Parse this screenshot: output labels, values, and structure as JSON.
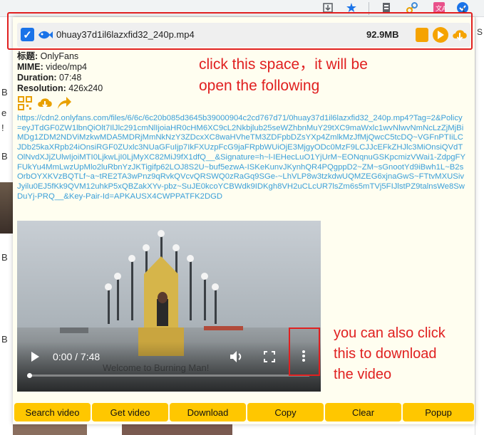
{
  "popup": {
    "file": {
      "name": "0huay37d1il6lazxfid32_240p.mp4",
      "size": "92.9MB",
      "checked": true
    },
    "info": {
      "title_label": "标题:",
      "title_value": "OnlyFans",
      "mime_label": "MIME:",
      "mime_value": "video/mp4",
      "duration_label": "Duration:",
      "duration_value": "07:48",
      "resolution_label": "Resolution:",
      "resolution_value": "426x240"
    },
    "url": "https://cdn2.onlyfans.com/files/6/6c/6c20b085d3645b39000904c2cd767d71/0huay37d1il6lazxfid32_240p.mp4?Tag=2&Policy=eyJTdGF0ZW1lbnQiOlt7IlJlc291cmNlIjoiaHR0cHM6XC9cL2Nkbjlub25seWZhbnMuY29tXC9maWxlc1wvNlwvNmNcLzZjMjBiMDg1ZDM2NDViMzkwMDA5MDRjMmNkNzY3ZDcxXC8waHVheTM3ZDFpbDZsYXp4ZmlkMzJfMjQwcC5tcDQ~VGFnPTIiLCJDb25kaXRpb24iOnsiRGF0ZUxlc3NUaGFuIjp7IkFXUzpFcG9jaFRpbWUiOjE3MjgyODc0MzF9LCJJcEFkZHJlc3MiOnsiQVdTOlNvdXJjZUlwIjoiMTI0LjkwLjI0LjMyXC82MiJ9fX1dfQ__&Signature=h~l-IEHecLuO1YjUrM~EONqnuGSKpcmizVWai1-ZdpgFYFUkYu4MmLwzUpMlo2luRbnYzJKTigifp62LOJ8S2U~buf5ezwA-ISKeKunvJKynhQR4PQgppD2~ZM~sGnootYd9iBwh1L~B2sOrbOYXKVzBQTLf~a~tRE2TA3wPnz9qRvkQVcvQRSWQ0zRaGq9SGe-~LhVLP8w3tzkdwUQMZEG6xjnaGwS~FTtvMXUSivJyilu0EJ5fKk9QVM12uhkP5xQBZakXYv-pbz~SuJE0kcoYCBWdk9IDKgh8VH2uCLcUR7lsZm6s5mTVj5FIJlstPZ9talnsWe8SwDuYj-PRQ__&Key-Pair-Id=APKAUSX4CWPPATFK2DGD",
    "video": {
      "time": "0:00 / 7:48",
      "subtitle": "Welcome to Burning Man!"
    },
    "buttons": {
      "search": "Search video",
      "get": "Get video",
      "download": "Download",
      "copy": "Copy",
      "clear": "Clear",
      "popup": "Popup"
    },
    "annotations": {
      "top_line1": "click this space，it will be",
      "top_line2": "open the following",
      "bottom_line1": "you can also click",
      "bottom_line2": "this to download",
      "bottom_line3": "the video"
    }
  },
  "background": {
    "left_chars": [
      "B",
      "e",
      "!",
      "B",
      "B",
      "B"
    ],
    "right_char": "S",
    "extension_badge": "1"
  },
  "colors": {
    "accent_red": "#e02020",
    "button_yellow": "#ffc700",
    "url_blue": "#3a9fd8",
    "popup_bg": "#fffef0"
  },
  "icons": [
    "download-page-icon",
    "bookmark-star-icon",
    "extensions-icon",
    "link-icon",
    "translate-icon",
    "video-downloader-icon",
    "qr-code-icon",
    "cloud-download-icon",
    "share-arrow-icon",
    "document-icon",
    "play-circle-icon",
    "cloud-download-icon",
    "play-icon",
    "volume-icon",
    "fullscreen-icon",
    "more-vertical-icon"
  ]
}
